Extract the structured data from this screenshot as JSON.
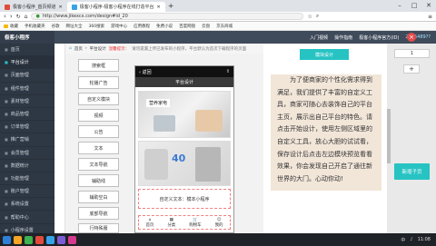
{
  "browser": {
    "tabs": [
      {
        "label": "极客小程序_首页频道",
        "color": "#e24b3b"
      },
      {
        "label": "极客小程序-极客小程序在线打造平台",
        "color": "#36a3e8"
      }
    ],
    "url": "http://www.jikexcx.com/design#id_20",
    "bookmarks": [
      "收藏",
      "手机收藏夹",
      "谷歌",
      "网址大全",
      "360搜索",
      "游戏中心",
      "应用教程",
      "免费小说",
      "百度网盘",
      "云盘",
      "京东商城"
    ]
  },
  "app": {
    "brand": "极客小程序",
    "header_links": [
      "入门视频",
      "操作指南",
      "极客小程序官方(ID)",
      "2925489??"
    ]
  },
  "sidebar": {
    "items": [
      {
        "label": "首页",
        "icon": "home-icon"
      },
      {
        "label": "平台设计",
        "icon": "design-icon",
        "active": true
      },
      {
        "label": "页面管理",
        "icon": "page-icon"
      },
      {
        "label": "组件管理",
        "icon": "component-icon"
      },
      {
        "label": "素材管理",
        "icon": "image-icon"
      },
      {
        "label": "商品管理",
        "icon": "goods-icon"
      },
      {
        "label": "订单管理",
        "icon": "order-icon"
      },
      {
        "label": "推广营销",
        "icon": "promo-icon"
      },
      {
        "label": "会员管理",
        "icon": "member-icon"
      },
      {
        "label": "数据统计",
        "icon": "stats-icon"
      },
      {
        "label": "功能管理",
        "icon": "feature-icon"
      },
      {
        "label": "账户管理",
        "icon": "account-icon"
      },
      {
        "label": "系统设置",
        "icon": "settings-icon"
      },
      {
        "label": "帮助中心",
        "icon": "help-icon"
      },
      {
        "label": "小程序设置",
        "icon": "miniapp-icon"
      }
    ]
  },
  "breadcrumb": {
    "home": "首页",
    "current": "平台设计",
    "tip_label": "温馨提示：",
    "tip_text": "请勿遗漏上传已发布的小程序，平台默认为首次下载程序的页面"
  },
  "components": [
    "搜索框",
    "轮播广告",
    "自定义模块",
    "视频",
    "公告",
    "文本",
    "文本导航",
    "辅助线",
    "辅助空白",
    "底部导航",
    "行特殊服"
  ],
  "phone": {
    "time": "11:08",
    "back": "返回",
    "title": "平台设计",
    "preview_caption": "营养家电",
    "text_block": "自定义文本：模本小程序",
    "badge": "40",
    "nav_items": [
      "首页",
      "分类",
      "购物车",
      "我的"
    ]
  },
  "panel": {
    "title": "模块设计",
    "paragraph": "为了便商家的个性化需求得到满足，我们提供了丰富的自定义工具，商家可随心去装饰自己的平台主页，展示出自己平台的特色。请点击开始设计，使用左侧区域里的自定义工具，放心大胆的试试看，保存设计后点击左边模块预览看看效果，你会发现自己开启了通往新世界的大门。心动你动!",
    "new_button": "新增子页",
    "quantity": "1"
  },
  "taskbar": {
    "time": "11:08",
    "date": "2019/1/1",
    "lang": "中"
  }
}
